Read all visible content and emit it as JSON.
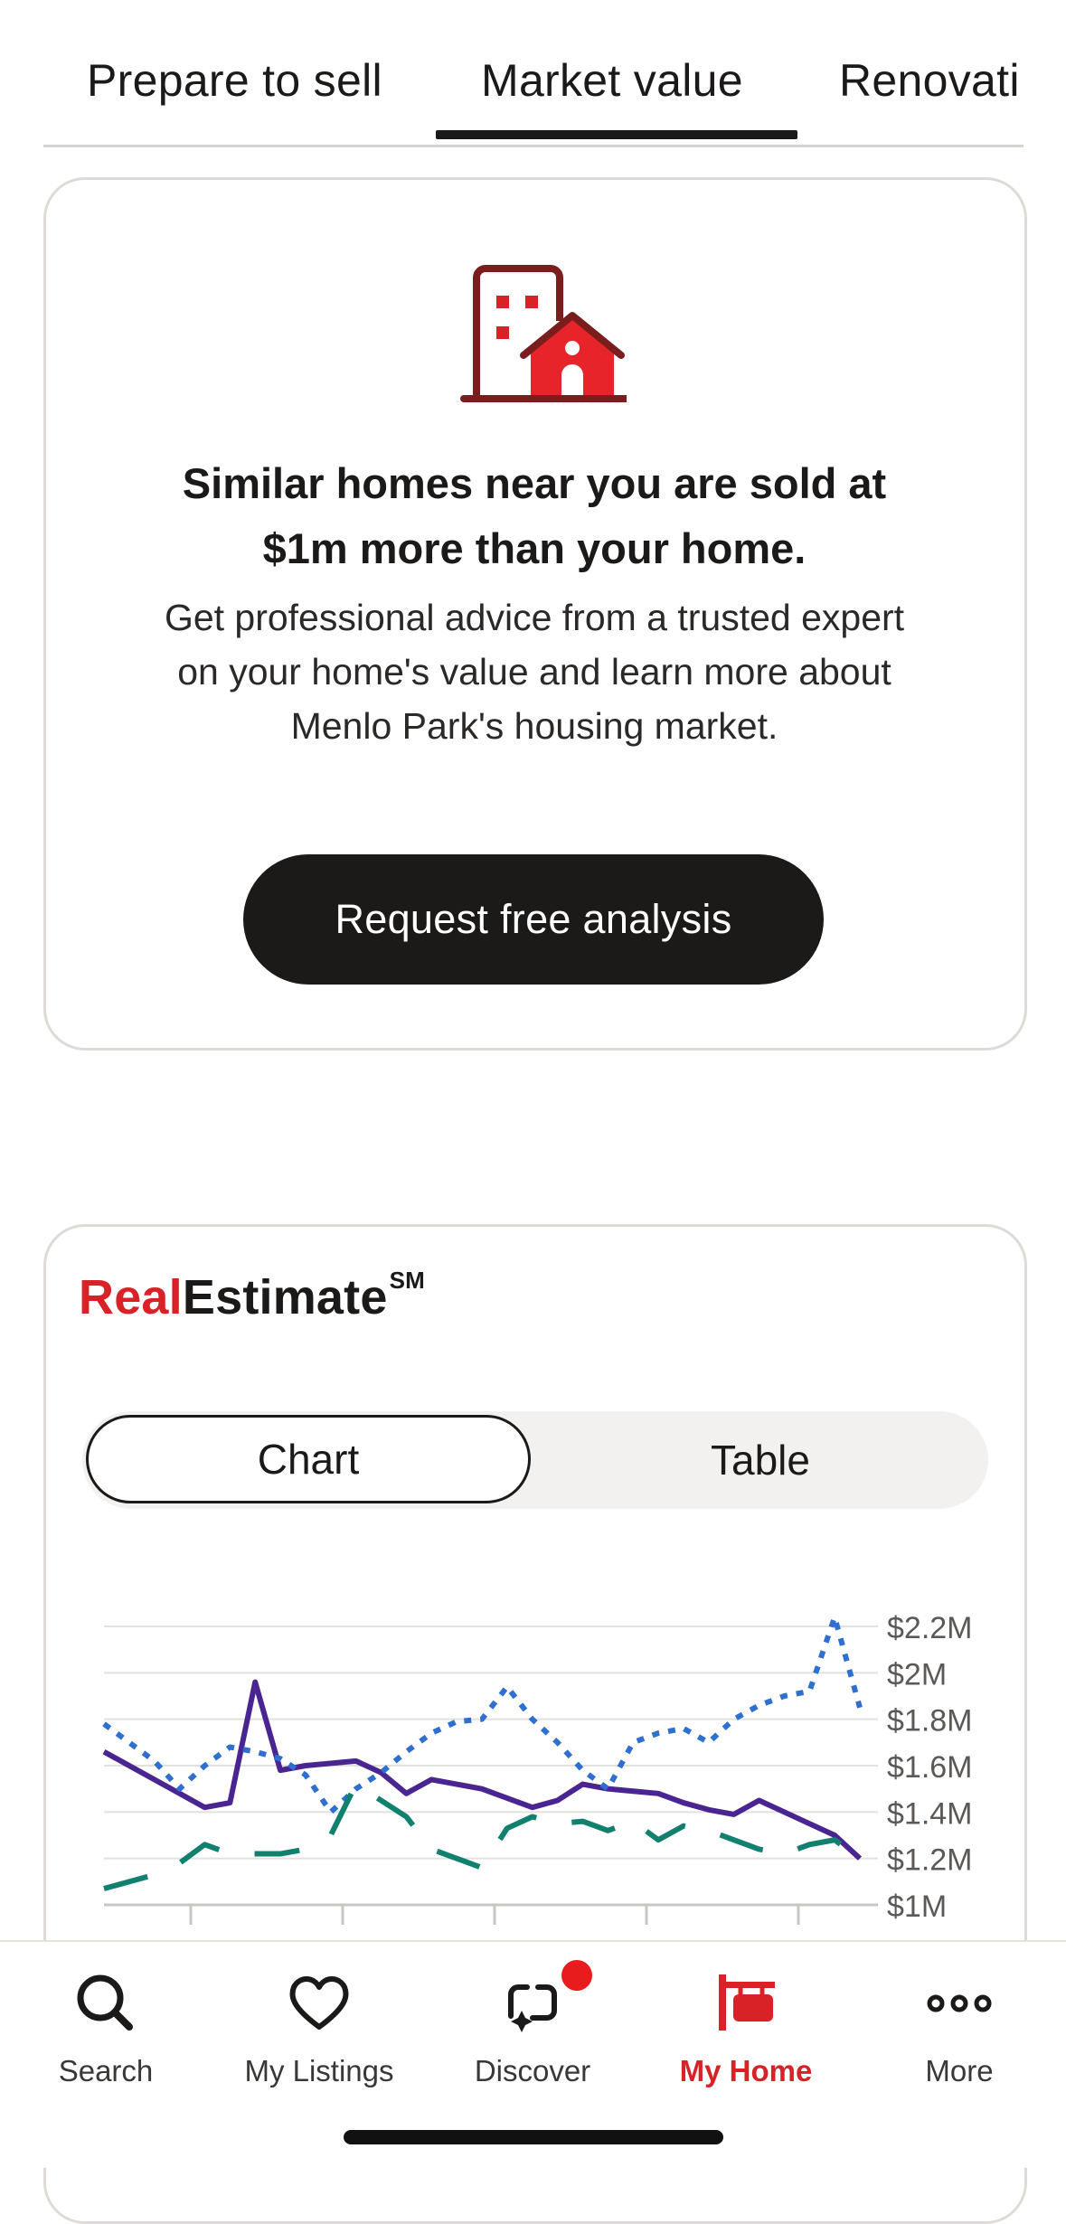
{
  "tabs": [
    {
      "label": "Prepare to sell"
    },
    {
      "label": "Market value"
    },
    {
      "label": "Renovati"
    }
  ],
  "promo": {
    "headline": "Similar homes near you are sold at $1m more than your home.",
    "body": "Get professional advice from a trusted expert on your home's value and learn more about Menlo Park's housing market.",
    "cta_label": "Request free analysis",
    "icon": "building-house-icon"
  },
  "estimate": {
    "brand_red": "Real",
    "brand_black": "Estimate",
    "brand_mark": "SM",
    "segments": {
      "chart": "Chart",
      "table": "Table"
    }
  },
  "chart_data": {
    "type": "line",
    "x": [
      0,
      1,
      2,
      3,
      4,
      5,
      6,
      7,
      8,
      9,
      10,
      11,
      12,
      13,
      14,
      15,
      16,
      17,
      18,
      19,
      20,
      21,
      22,
      23,
      24,
      25,
      26,
      27,
      28,
      29,
      30
    ],
    "y_ticks": [
      "$2.2M",
      "$2M",
      "$1.8M",
      "$1.6M",
      "$1.4M",
      "$1.2M",
      "$1M"
    ],
    "ylim": [
      1.0,
      2.2
    ],
    "grid": true,
    "series": [
      {
        "color": "#4a2491",
        "style": "solid",
        "values": [
          1.66,
          1.6,
          1.54,
          1.48,
          1.42,
          1.44,
          1.96,
          1.58,
          1.6,
          1.61,
          1.62,
          1.57,
          1.48,
          1.54,
          1.52,
          1.5,
          1.46,
          1.42,
          1.45,
          1.52,
          1.5,
          1.49,
          1.48,
          1.44,
          1.41,
          1.39,
          1.45,
          1.4,
          1.35,
          1.3,
          1.2
        ]
      },
      {
        "color": "#2f6fcf",
        "style": "dotted",
        "values": [
          1.78,
          1.7,
          1.62,
          1.5,
          1.6,
          1.68,
          1.66,
          1.63,
          1.56,
          1.4,
          1.5,
          1.57,
          1.66,
          1.74,
          1.79,
          1.8,
          1.94,
          1.8,
          1.7,
          1.58,
          1.5,
          1.7,
          1.74,
          1.76,
          1.7,
          1.8,
          1.86,
          1.9,
          1.92,
          2.24,
          1.85
        ]
      },
      {
        "color": "#12806f",
        "style": "dashed",
        "values": [
          1.07,
          1.1,
          1.13,
          1.18,
          1.26,
          1.22,
          1.22,
          1.22,
          1.24,
          1.3,
          1.52,
          1.45,
          1.38,
          1.24,
          1.2,
          1.16,
          1.33,
          1.38,
          1.35,
          1.36,
          1.32,
          1.36,
          1.28,
          1.34,
          1.32,
          1.28,
          1.24,
          1.22,
          1.26,
          1.28,
          1.2
        ]
      }
    ]
  },
  "nav": [
    {
      "label": "Search",
      "icon": "search-icon"
    },
    {
      "label": "My Listings",
      "icon": "heart-icon"
    },
    {
      "label": "Discover",
      "icon": "discover-icon"
    },
    {
      "label": "My Home",
      "icon": "home-sign-icon"
    },
    {
      "label": "More",
      "icon": "more-icon"
    }
  ],
  "colors": {
    "accent": "#d92228",
    "ink": "#1b1a19",
    "border": "#dedbd7"
  }
}
